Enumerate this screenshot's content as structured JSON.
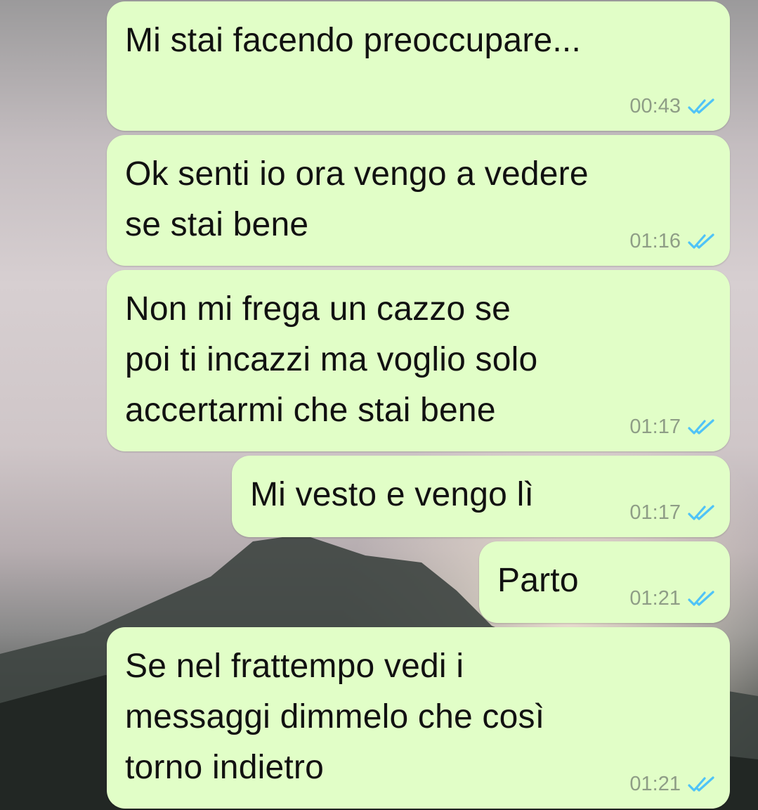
{
  "chat": {
    "messages": [
      {
        "text": "Mi stai facendo preoccupare...",
        "time": "00:43",
        "status_icon": "double-check-read-icon"
      },
      {
        "text": "Ok senti io ora vengo a vedere\nse stai bene",
        "time": "01:16",
        "status_icon": "double-check-read-icon"
      },
      {
        "text": "Non mi frega un cazzo se\npoi ti incazzi ma voglio solo\naccertarmi che stai bene",
        "time": "01:17",
        "status_icon": "double-check-read-icon"
      },
      {
        "text": "Mi vesto e vengo lì",
        "time": "01:17",
        "status_icon": "double-check-read-icon"
      },
      {
        "text": "Parto",
        "time": "01:21",
        "status_icon": "double-check-read-icon"
      },
      {
        "text": "Se nel frattempo vedi i\nmessaggi dimmelo che così\ntorno indietro",
        "time": "01:21",
        "status_icon": "double-check-read-icon"
      }
    ]
  },
  "colors": {
    "outgoing_bubble": "#e1fec7",
    "read_tick": "#4fc3f7",
    "time_text": "#8e9d86"
  }
}
